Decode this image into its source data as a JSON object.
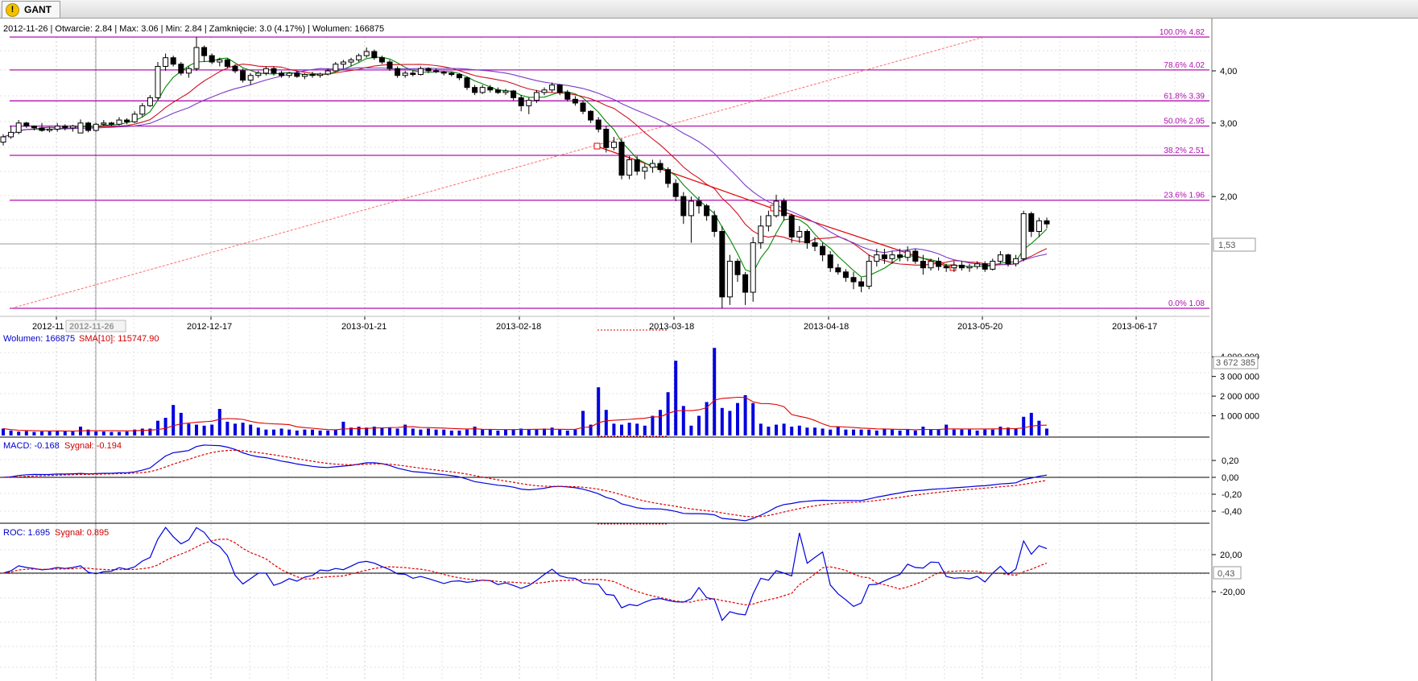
{
  "tab": {
    "label": "GANT"
  },
  "info_line": "2012-11-26 | Otwarcie: 2.84 | Max: 3.06 | Min: 2.84 | Zamknięcie: 3.0 (4.17%)  | Wolumen: 166875",
  "colors": {
    "candle_down": "#000000",
    "fib": "#b010b0",
    "sma_short": "#008800",
    "sma_mid": "#d01020",
    "sma_long": "#7a3ac8",
    "volume": "#0000e0",
    "volume_sma": "#e00000",
    "macd": "#0000e0",
    "signal": "#e00000",
    "grid": "#cccccc"
  },
  "x_axis": {
    "labels": [
      "2012-11",
      "2012-12-17",
      "2013-01-21",
      "2013-02-18",
      "2013-03-18",
      "2013-04-18",
      "2013-05-20",
      "2013-06-17"
    ],
    "cursor_label": "2012-11-26"
  },
  "price_axis": {
    "ticks": [
      "4,00",
      "3,00",
      "2,00"
    ],
    "last": "1,53"
  },
  "fib_levels": [
    {
      "label": "100.0% 4.82",
      "value": 4.82
    },
    {
      "label": "78.6% 4.02",
      "value": 4.02
    },
    {
      "label": "61.8% 3.39",
      "value": 3.39
    },
    {
      "label": "50.0% 2.95",
      "value": 2.95
    },
    {
      "label": "38.2% 2.51",
      "value": 2.51
    },
    {
      "label": "23.6% 1.96",
      "value": 1.96
    },
    {
      "label": "0.0% 1.08",
      "value": 1.08
    }
  ],
  "volume_panel": {
    "legend_vol": "Wolumen: 166875",
    "legend_sma": "SMA[10]: 115747.90",
    "ticks": [
      "4 000 000",
      "3 000 000",
      "2 000 000",
      "1 000 000"
    ],
    "last": "3 672 385"
  },
  "macd_panel": {
    "legend_macd": "MACD: -0.168",
    "legend_signal": "Sygnał: -0.194",
    "ticks": [
      "0,20",
      "0,00",
      "-0,20",
      "-0,40"
    ]
  },
  "roc_panel": {
    "legend_roc": "ROC: 1.695",
    "legend_signal": "Sygnał: 0.895",
    "ticks": [
      "20,00",
      "-20,00"
    ],
    "last": "0,43"
  },
  "chart_data": {
    "type": "candlestick",
    "title": "GANT",
    "fib_range": [
      1.08,
      4.82
    ],
    "ohlc": [
      [
        2.7,
        2.82,
        2.65,
        2.78
      ],
      [
        2.78,
        2.95,
        2.75,
        2.85
      ],
      [
        2.85,
        3.05,
        2.82,
        3.0
      ],
      [
        3.0,
        3.02,
        2.92,
        2.95
      ],
      [
        2.95,
        2.96,
        2.88,
        2.92
      ],
      [
        2.92,
        3.0,
        2.86,
        2.88
      ],
      [
        2.88,
        2.93,
        2.85,
        2.9
      ],
      [
        2.9,
        3.0,
        2.86,
        2.95
      ],
      [
        2.95,
        2.98,
        2.88,
        2.92
      ],
      [
        2.92,
        2.97,
        2.86,
        2.95
      ],
      [
        2.84,
        3.06,
        2.84,
        3.0
      ],
      [
        3.0,
        3.02,
        2.85,
        2.88
      ],
      [
        2.88,
        3.0,
        2.86,
        2.98
      ],
      [
        2.98,
        3.05,
        2.95,
        3.0
      ],
      [
        3.0,
        3.02,
        2.95,
        2.98
      ],
      [
        2.98,
        3.1,
        2.96,
        3.05
      ],
      [
        3.05,
        3.08,
        2.98,
        3.02
      ],
      [
        3.02,
        3.2,
        3.0,
        3.15
      ],
      [
        3.15,
        3.35,
        3.1,
        3.3
      ],
      [
        3.3,
        3.5,
        3.28,
        3.45
      ],
      [
        3.45,
        4.2,
        3.4,
        4.1
      ],
      [
        4.1,
        4.4,
        4.0,
        4.3
      ],
      [
        4.3,
        4.35,
        4.1,
        4.15
      ],
      [
        4.15,
        4.2,
        3.9,
        3.95
      ],
      [
        3.95,
        4.1,
        3.85,
        4.05
      ],
      [
        4.05,
        4.82,
        4.0,
        4.55
      ],
      [
        4.55,
        4.6,
        4.2,
        4.35
      ],
      [
        4.35,
        4.4,
        4.15,
        4.2
      ],
      [
        4.2,
        4.3,
        4.1,
        4.25
      ],
      [
        4.25,
        4.28,
        4.05,
        4.1
      ],
      [
        4.1,
        4.15,
        3.95,
        4.0
      ],
      [
        4.0,
        4.05,
        3.75,
        3.8
      ],
      [
        3.8,
        3.95,
        3.7,
        3.9
      ],
      [
        3.9,
        4.0,
        3.85,
        3.95
      ],
      [
        3.95,
        4.1,
        3.9,
        4.05
      ],
      [
        4.05,
        4.1,
        3.9,
        3.95
      ],
      [
        3.95,
        4.0,
        3.85,
        3.9
      ],
      [
        3.9,
        3.98,
        3.85,
        3.95
      ],
      [
        3.95,
        4.0,
        3.85,
        3.88
      ],
      [
        3.88,
        3.95,
        3.82,
        3.92
      ],
      [
        3.92,
        3.98,
        3.85,
        3.9
      ],
      [
        3.9,
        3.96,
        3.85,
        3.93
      ],
      [
        3.93,
        4.05,
        3.9,
        4.0
      ],
      [
        4.0,
        4.2,
        3.98,
        4.15
      ],
      [
        4.15,
        4.25,
        4.05,
        4.2
      ],
      [
        4.2,
        4.3,
        4.1,
        4.25
      ],
      [
        4.25,
        4.4,
        4.2,
        4.35
      ],
      [
        4.35,
        4.55,
        4.3,
        4.45
      ],
      [
        4.45,
        4.5,
        4.25,
        4.3
      ],
      [
        4.3,
        4.35,
        4.15,
        4.2
      ],
      [
        4.2,
        4.25,
        4.0,
        4.05
      ],
      [
        4.05,
        4.1,
        3.85,
        3.9
      ],
      [
        3.9,
        4.0,
        3.85,
        3.95
      ],
      [
        3.95,
        4.0,
        3.88,
        3.92
      ],
      [
        3.92,
        4.1,
        3.9,
        4.05
      ],
      [
        4.05,
        4.08,
        3.95,
        4.0
      ],
      [
        4.0,
        4.05,
        3.95,
        3.98
      ],
      [
        3.98,
        4.0,
        3.9,
        3.95
      ],
      [
        3.95,
        3.98,
        3.88,
        3.92
      ],
      [
        3.92,
        3.95,
        3.8,
        3.85
      ],
      [
        3.85,
        3.88,
        3.6,
        3.65
      ],
      [
        3.65,
        3.7,
        3.5,
        3.55
      ],
      [
        3.55,
        3.7,
        3.52,
        3.65
      ],
      [
        3.65,
        3.7,
        3.55,
        3.6
      ],
      [
        3.6,
        3.65,
        3.52,
        3.55
      ],
      [
        3.55,
        3.62,
        3.5,
        3.58
      ],
      [
        3.58,
        3.6,
        3.4,
        3.45
      ],
      [
        3.45,
        3.5,
        3.2,
        3.3
      ],
      [
        3.3,
        3.45,
        3.15,
        3.4
      ],
      [
        3.4,
        3.6,
        3.35,
        3.55
      ],
      [
        3.55,
        3.65,
        3.5,
        3.6
      ],
      [
        3.6,
        3.75,
        3.55,
        3.7
      ],
      [
        3.7,
        3.72,
        3.5,
        3.55
      ],
      [
        3.55,
        3.6,
        3.38,
        3.42
      ],
      [
        3.42,
        3.48,
        3.3,
        3.35
      ],
      [
        3.35,
        3.4,
        3.15,
        3.2
      ],
      [
        3.2,
        3.22,
        3.0,
        3.05
      ],
      [
        3.05,
        3.1,
        2.85,
        2.9
      ],
      [
        2.9,
        2.95,
        2.55,
        2.62
      ],
      [
        2.62,
        2.78,
        2.58,
        2.7
      ],
      [
        2.7,
        2.75,
        2.2,
        2.25
      ],
      [
        2.25,
        2.5,
        2.2,
        2.45
      ],
      [
        2.45,
        2.5,
        2.25,
        2.3
      ],
      [
        2.3,
        2.4,
        2.2,
        2.35
      ],
      [
        2.35,
        2.45,
        2.28,
        2.4
      ],
      [
        2.4,
        2.45,
        2.28,
        2.32
      ],
      [
        2.32,
        2.35,
        2.1,
        2.15
      ],
      [
        2.15,
        2.2,
        1.95,
        2.0
      ],
      [
        2.0,
        2.05,
        1.72,
        1.8
      ],
      [
        1.8,
        2.0,
        1.55,
        1.95
      ],
      [
        1.95,
        2.0,
        1.82,
        1.9
      ],
      [
        1.9,
        1.92,
        1.75,
        1.8
      ],
      [
        1.8,
        1.85,
        1.6,
        1.65
      ],
      [
        1.65,
        1.7,
        1.08,
        1.15
      ],
      [
        1.15,
        1.45,
        1.1,
        1.4
      ],
      [
        1.4,
        1.42,
        1.25,
        1.3
      ],
      [
        1.3,
        1.32,
        1.1,
        1.18
      ],
      [
        1.18,
        1.6,
        1.12,
        1.55
      ],
      [
        1.55,
        1.8,
        1.5,
        1.7
      ],
      [
        1.7,
        1.85,
        1.65,
        1.8
      ],
      [
        1.8,
        2.02,
        1.78,
        1.95
      ],
      [
        1.95,
        1.98,
        1.75,
        1.8
      ],
      [
        1.8,
        1.82,
        1.55,
        1.6
      ],
      [
        1.6,
        1.7,
        1.55,
        1.65
      ],
      [
        1.65,
        1.67,
        1.5,
        1.55
      ],
      [
        1.55,
        1.6,
        1.48,
        1.52
      ],
      [
        1.52,
        1.55,
        1.4,
        1.45
      ],
      [
        1.45,
        1.48,
        1.32,
        1.35
      ],
      [
        1.35,
        1.38,
        1.3,
        1.32
      ],
      [
        1.32,
        1.34,
        1.25,
        1.28
      ],
      [
        1.28,
        1.32,
        1.2,
        1.25
      ],
      [
        1.25,
        1.28,
        1.18,
        1.22
      ],
      [
        1.22,
        1.45,
        1.2,
        1.4
      ],
      [
        1.4,
        1.5,
        1.36,
        1.45
      ],
      [
        1.45,
        1.5,
        1.38,
        1.42
      ],
      [
        1.42,
        1.48,
        1.38,
        1.45
      ],
      [
        1.45,
        1.5,
        1.4,
        1.43
      ],
      [
        1.43,
        1.52,
        1.4,
        1.48
      ],
      [
        1.48,
        1.5,
        1.38,
        1.4
      ],
      [
        1.4,
        1.45,
        1.3,
        1.35
      ],
      [
        1.35,
        1.42,
        1.33,
        1.4
      ],
      [
        1.4,
        1.43,
        1.33,
        1.36
      ],
      [
        1.36,
        1.38,
        1.32,
        1.35
      ],
      [
        1.35,
        1.4,
        1.32,
        1.37
      ],
      [
        1.37,
        1.4,
        1.33,
        1.35
      ],
      [
        1.35,
        1.38,
        1.32,
        1.36
      ],
      [
        1.36,
        1.4,
        1.34,
        1.38
      ],
      [
        1.38,
        1.4,
        1.32,
        1.34
      ],
      [
        1.34,
        1.42,
        1.33,
        1.4
      ],
      [
        1.4,
        1.48,
        1.38,
        1.45
      ],
      [
        1.45,
        1.46,
        1.36,
        1.38
      ],
      [
        1.38,
        1.45,
        1.36,
        1.42
      ],
      [
        1.42,
        1.85,
        1.4,
        1.82
      ],
      [
        1.82,
        1.84,
        1.6,
        1.65
      ],
      [
        1.65,
        1.78,
        1.6,
        1.75
      ],
      [
        1.75,
        1.78,
        1.68,
        1.72
      ]
    ],
    "volume": [
      0.35,
      0.25,
      0.2,
      0.22,
      0.18,
      0.2,
      0.2,
      0.25,
      0.22,
      0.2,
      0.45,
      0.3,
      0.2,
      0.2,
      0.18,
      0.18,
      0.2,
      0.3,
      0.35,
      0.35,
      0.75,
      0.9,
      1.55,
      1.15,
      0.6,
      0.55,
      0.5,
      0.55,
      1.35,
      0.7,
      0.6,
      0.65,
      0.55,
      0.4,
      0.3,
      0.3,
      0.35,
      0.3,
      0.25,
      0.3,
      0.3,
      0.25,
      0.25,
      0.3,
      0.7,
      0.4,
      0.45,
      0.4,
      0.45,
      0.4,
      0.4,
      0.35,
      0.55,
      0.35,
      0.3,
      0.35,
      0.3,
      0.3,
      0.25,
      0.25,
      0.3,
      0.45,
      0.3,
      0.3,
      0.25,
      0.3,
      0.3,
      0.35,
      0.3,
      0.3,
      0.35,
      0.4,
      0.3,
      0.25,
      0.3,
      1.25,
      0.55,
      2.45,
      1.3,
      0.6,
      0.55,
      0.65,
      0.6,
      0.5,
      1.0,
      1.3,
      2.2,
      3.8,
      1.5,
      0.5,
      1.0,
      1.7,
      4.45,
      1.4,
      1.25,
      1.65,
      2.05,
      1.65,
      0.6,
      0.45,
      0.55,
      0.6,
      0.45,
      0.5,
      0.4,
      0.4,
      0.35,
      0.3,
      0.45,
      0.3,
      0.3,
      0.3,
      0.3,
      0.25,
      0.35,
      0.3,
      0.25,
      0.3,
      0.25,
      0.45,
      0.3,
      0.3,
      0.55,
      0.3,
      0.3,
      0.3,
      0.25,
      0.3,
      0.3,
      0.45,
      0.4,
      0.35,
      0.95,
      1.15,
      0.75,
      0.35
    ],
    "volume_unit": "shares",
    "macd_range": [
      -0.5,
      0.3
    ],
    "roc_range": [
      -30,
      30
    ]
  }
}
